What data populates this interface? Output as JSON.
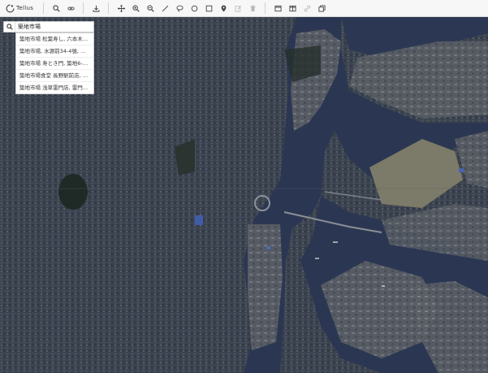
{
  "app": {
    "logo_text": "Tellus"
  },
  "toolbar": {
    "buttons": [
      {
        "icon": "search-icon"
      },
      {
        "icon": "link-icon"
      },
      {
        "icon": "download-icon"
      },
      {
        "icon": "pan-icon"
      },
      {
        "icon": "zoom-in-icon"
      },
      {
        "icon": "zoom-out-icon"
      },
      {
        "icon": "line-icon"
      },
      {
        "icon": "lasso-icon"
      },
      {
        "icon": "circle-icon"
      },
      {
        "icon": "rectangle-icon"
      },
      {
        "icon": "marker-icon"
      },
      {
        "icon": "edit-icon"
      },
      {
        "icon": "trash-icon"
      },
      {
        "icon": "window-icon"
      },
      {
        "icon": "split-view-icon"
      },
      {
        "icon": "chain-link-icon"
      },
      {
        "icon": "copy-icon"
      }
    ]
  },
  "search": {
    "value": "築地市場",
    "suggestions": [
      "築地市場 松葉寿し, 六本木…",
      "築地市場, 水源前34-4號, 大…",
      "築地市場 寿とき門, 築地6-…",
      "築地市場食堂 長野駅前店, …",
      "築地市場 浅草雷門店, 雷門…"
    ]
  },
  "colors": {
    "toolbar_bg": "#f7f7f7",
    "water": "#2d3a55",
    "urban": "#3d4550"
  }
}
